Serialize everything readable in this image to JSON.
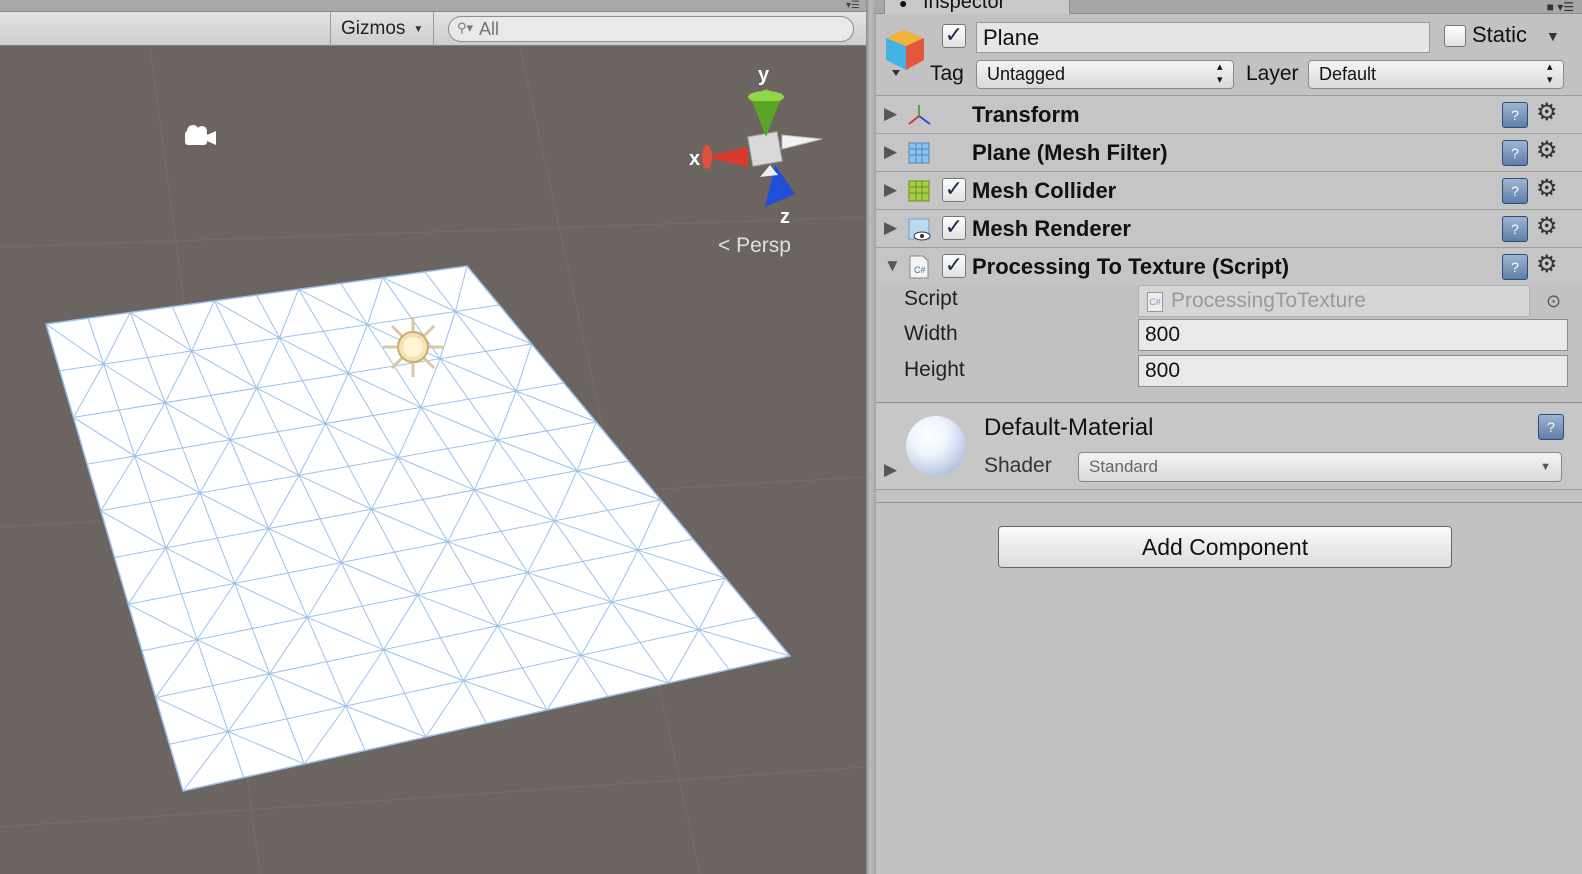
{
  "scene": {
    "gizmos_label": "Gizmos",
    "search_placeholder": "All",
    "persp_label": "Persp",
    "axis_labels": {
      "x": "x",
      "y": "y",
      "z": "z"
    }
  },
  "inspector": {
    "tab_title": "Inspector",
    "game_object": {
      "name": "Plane",
      "active": true,
      "static_label": "Static",
      "static": false,
      "tag_label": "Tag",
      "tag_value": "Untagged",
      "layer_label": "Layer",
      "layer_value": "Default"
    },
    "components": [
      {
        "label": "Transform",
        "has_checkbox": false,
        "icon": "transform-icon"
      },
      {
        "label": "Plane (Mesh Filter)",
        "has_checkbox": false,
        "icon": "mesh-filter-icon"
      },
      {
        "label": "Mesh Collider",
        "has_checkbox": true,
        "checked": true,
        "icon": "mesh-collider-icon"
      },
      {
        "label": "Mesh Renderer",
        "has_checkbox": true,
        "checked": true,
        "icon": "mesh-renderer-icon"
      },
      {
        "label": "Processing To Texture (Script)",
        "has_checkbox": true,
        "checked": true,
        "icon": "csharp-script-icon"
      }
    ],
    "script_props": {
      "script_label": "Script",
      "script_value": "ProcessingToTexture",
      "width_label": "Width",
      "width_value": "800",
      "height_label": "Height",
      "height_value": "800"
    },
    "material": {
      "name": "Default-Material",
      "shader_label": "Shader",
      "shader_value": "Standard"
    },
    "add_component_label": "Add Component"
  }
}
